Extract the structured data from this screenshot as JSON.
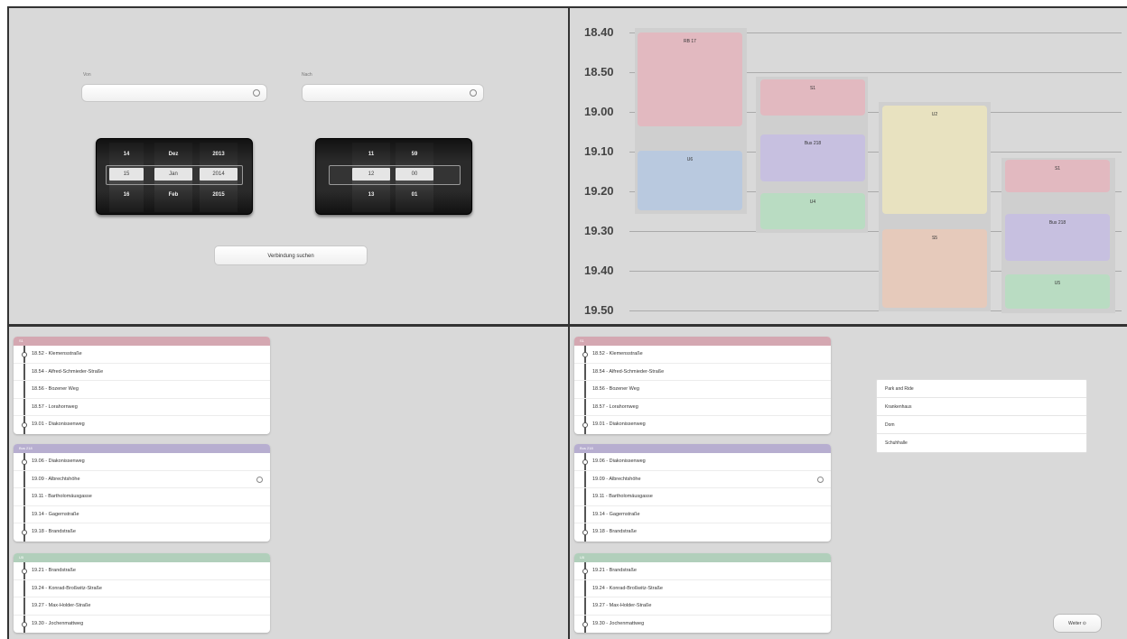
{
  "search": {
    "from_label": "Von",
    "to_label": "Nach",
    "date_picker": {
      "days": [
        "14",
        "15",
        "16"
      ],
      "months": [
        "Dez",
        "Jan",
        "Feb"
      ],
      "years": [
        "2013",
        "2014",
        "2015"
      ]
    },
    "time_picker": {
      "hours": [
        "11",
        "12",
        "13"
      ],
      "minutes": [
        "59",
        "00",
        "01"
      ]
    },
    "search_button": "Verbindung suchen"
  },
  "schedule": {
    "times": [
      "18.40",
      "18.50",
      "19.00",
      "19.10",
      "19.20",
      "19.30",
      "19.40",
      "19.50"
    ],
    "blocks": [
      {
        "label": "RB 17",
        "color": "#e2b9c0"
      },
      {
        "label": "U6",
        "color": "#b9c9df"
      },
      {
        "label": "S1",
        "color": "#e2b9c0"
      },
      {
        "label": "Bus 218",
        "color": "#c7c0e0"
      },
      {
        "label": "U4",
        "color": "#b9dcc2"
      },
      {
        "label": "U2",
        "color": "#e8e2c0"
      },
      {
        "label": "S5",
        "color": "#e6cabb"
      },
      {
        "label": "S1",
        "color": "#e2b9c0"
      },
      {
        "label": "Bus 218",
        "color": "#c7c0e0"
      },
      {
        "label": "U5",
        "color": "#b9dcc2"
      }
    ]
  },
  "route": {
    "legs": [
      {
        "line": "S1",
        "color": "#d4a7b1",
        "stops": [
          "18.52 - Klemensstraße",
          "18.54 - Alfred-Schmieder-Straße",
          "18.56 - Bozener Weg",
          "18.57 - Lorahornweg",
          "19.01 - Diakonissenweg"
        ]
      },
      {
        "line": "Bus 218",
        "color": "#b7aed0",
        "stops": [
          "19.06 - Diakonissenweg",
          "19.09 - Albrechtshöhe",
          "19.11 - Bartholomäusgasse",
          "19.14 - Gagernstraße",
          "19.18 - Brandstraße"
        ]
      },
      {
        "line": "U5",
        "color": "#b1cfbb",
        "stops": [
          "19.21 - Brandstraße",
          "19.24 - Konrad-Broßwitz-Straße",
          "19.27 - Max-Holder-Straße",
          "19.30 - Jochenmattweg"
        ]
      }
    ]
  },
  "suggestions": [
    "Park and Ride",
    "Krankenhaus",
    "Dom",
    "Schuhhalle"
  ],
  "next_button": "Weiter"
}
